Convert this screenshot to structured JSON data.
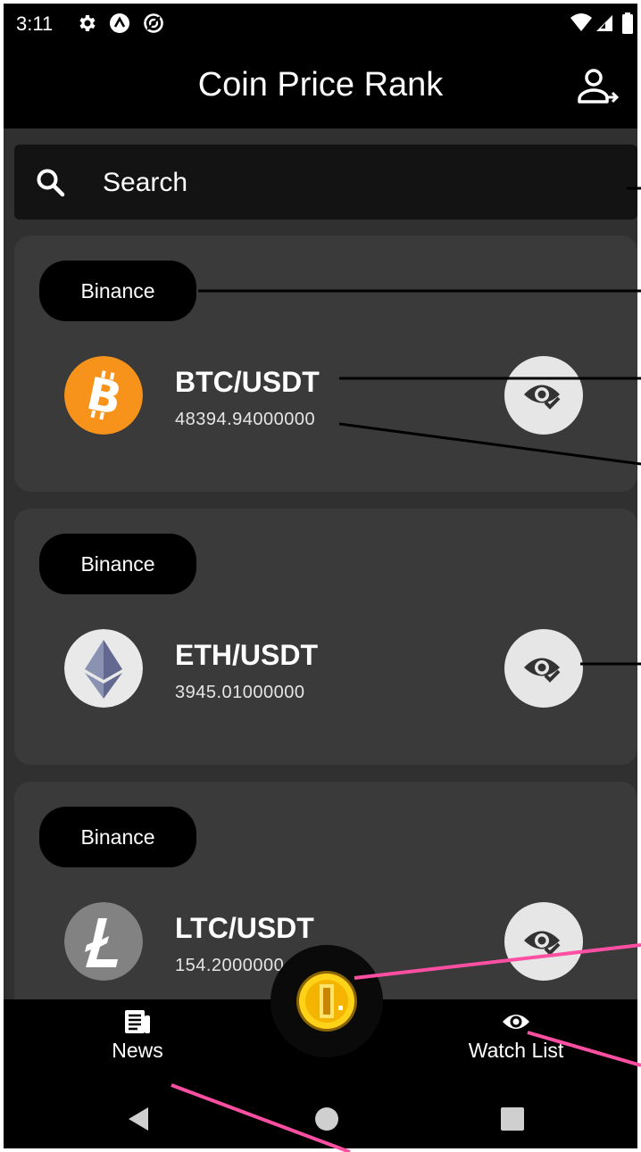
{
  "status_bar": {
    "time": "3:11",
    "icons": [
      "gear-icon",
      "app-a-icon",
      "sync-icon",
      "wifi-icon",
      "signal-icon",
      "battery-icon"
    ]
  },
  "app_bar": {
    "title": "Coin Price Rank",
    "profile_icon": "account-arrow-icon"
  },
  "search": {
    "placeholder": "Search",
    "icon": "search-icon"
  },
  "coins": [
    {
      "exchange": "Binance",
      "pair": "BTC/USDT",
      "price": "48394.94000000",
      "logo": "bitcoin-logo",
      "logo_color": "#f7931a"
    },
    {
      "exchange": "Binance",
      "pair": "ETH/USDT",
      "price": "3945.01000000",
      "logo": "ethereum-logo",
      "logo_color": "#e9e9e9"
    },
    {
      "exchange": "Binance",
      "pair": "LTC/USDT",
      "price": "154.2000000",
      "logo": "litecoin-logo",
      "logo_color": "#828282"
    }
  ],
  "bottom_nav": {
    "news_label": "News",
    "watch_label": "Watch List",
    "center_icon": "gold-coin-icon"
  },
  "system_nav": [
    "back-icon",
    "home-icon",
    "recents-icon"
  ],
  "colors": {
    "background": "#303030",
    "card": "#3a3a3a",
    "bar": "#000000",
    "accent_pink": "#ff4fa3",
    "btc_orange": "#f7931a"
  }
}
